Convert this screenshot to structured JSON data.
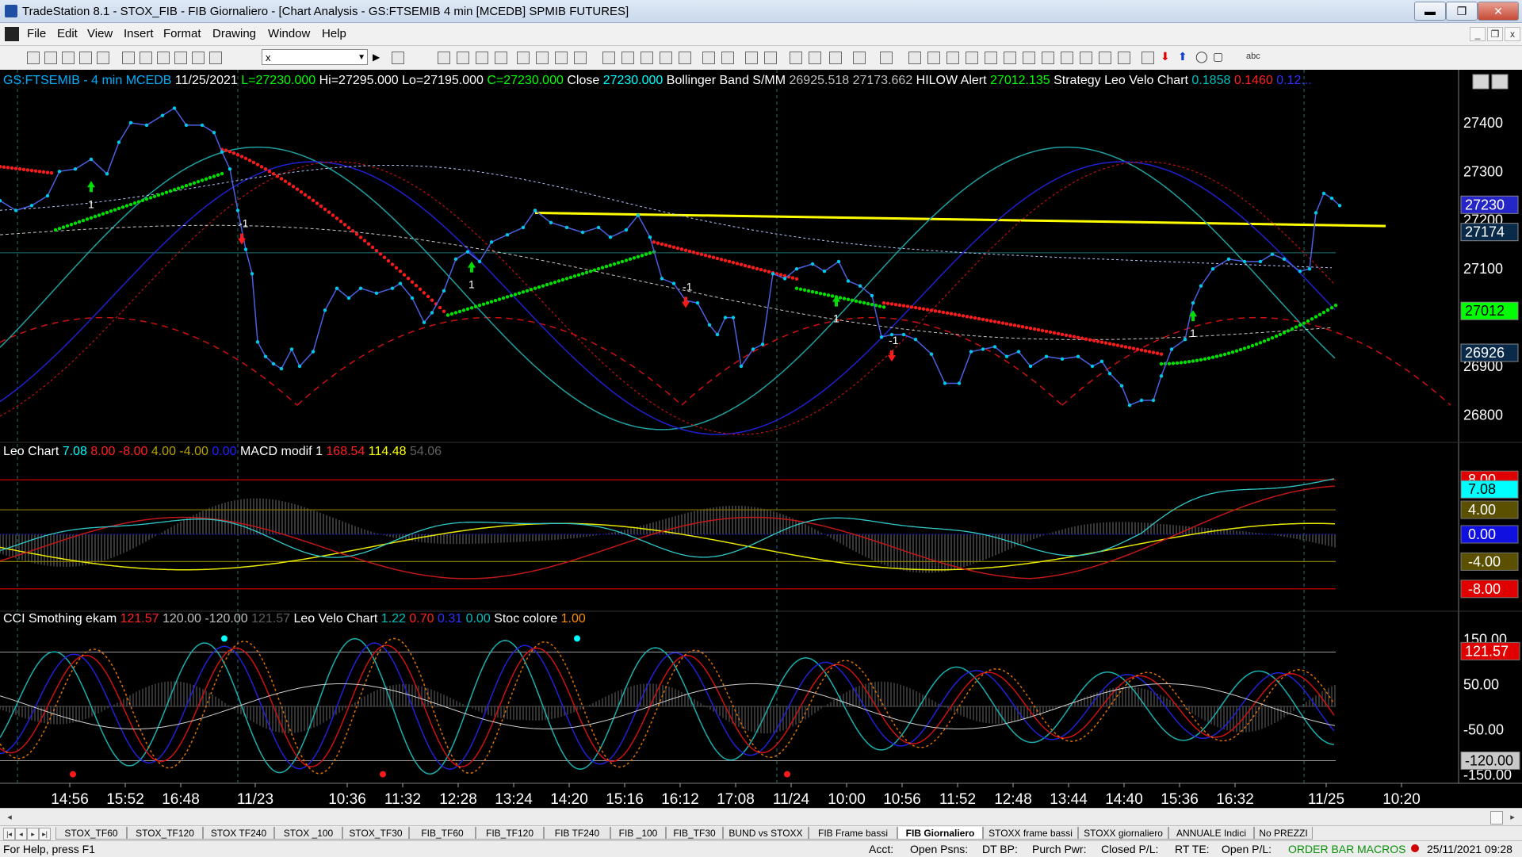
{
  "window": {
    "title": "TradeStation 8.1 - STOX_FIB - FIB Giornaliero - [Chart Analysis - GS:FTSEMIB  4 min  [MCEDB] SPMIB FUTURES]",
    "minimize_label": "▬",
    "restore_label": "❐",
    "close_label": "✕"
  },
  "menu": {
    "items": [
      "File",
      "Edit",
      "View",
      "Insert",
      "Format",
      "Drawing",
      "Window",
      "Help"
    ],
    "child_minimize": "_",
    "child_restore": "❐",
    "child_close": "x"
  },
  "toolbar": {
    "symbol_value": "x"
  },
  "price_panel": {
    "legend": [
      {
        "text": "GS:FTSEMIB - 4 min   MCEDB",
        "color": "#00b0ff"
      },
      {
        "text": "11/25/2021",
        "color": "#ffffff"
      },
      {
        "text": "L=27230.000",
        "color": "#00ff00"
      },
      {
        "text": "Hi=27295.000",
        "color": "#ffffff"
      },
      {
        "text": "Lo=27195.000",
        "color": "#ffffff"
      },
      {
        "text": "C=27230.000",
        "color": "#00ff00"
      },
      {
        "text": "Close",
        "color": "#ffffff"
      },
      {
        "text": "27230.000",
        "color": "#00ffff"
      },
      {
        "text": "Bollinger Band S/MM",
        "color": "#ffffff"
      },
      {
        "text": "26925.518",
        "color": "#c0c0c0"
      },
      {
        "text": "27173.662",
        "color": "#c0c0c0"
      },
      {
        "text": "HILOW Alert",
        "color": "#ffffff"
      },
      {
        "text": "27012.135",
        "color": "#00ff00"
      },
      {
        "text": "Strategy",
        "color": "#ffffff"
      },
      {
        "text": "Leo Velo Chart",
        "color": "#ffffff"
      },
      {
        "text": "0.1858",
        "color": "#00c0c0"
      },
      {
        "text": "0.1460",
        "color": "#ff2020"
      },
      {
        "text": "0.12...",
        "color": "#3030ff"
      }
    ],
    "y_ticks": [
      "27400",
      "27300",
      "27200",
      "27100",
      "26900",
      "26800"
    ],
    "y_min": 26760,
    "y_max": 27460,
    "markers": [
      {
        "label": "27230",
        "value": 27230,
        "bg": "#2525c8",
        "fg": "#ffffff"
      },
      {
        "label": "27174",
        "value": 27174,
        "bg": "#0a2a4a",
        "fg": "#ffffff"
      },
      {
        "label": "27012",
        "value": 27012,
        "bg": "#00ff00",
        "fg": "#000000"
      },
      {
        "label": "26926",
        "value": 26926,
        "bg": "#0a2a4a",
        "fg": "#ffffff"
      }
    ],
    "signals": [
      {
        "label": "1",
        "arrow": "up"
      },
      {
        "label": "-1",
        "arrow": "down"
      },
      {
        "label": "1",
        "arrow": "up"
      },
      {
        "label": "-1",
        "arrow": "down"
      },
      {
        "label": "1",
        "arrow": "up"
      },
      {
        "label": "-1",
        "arrow": "down"
      },
      {
        "label": "1",
        "arrow": "up"
      }
    ]
  },
  "osc_panel": {
    "legend": [
      {
        "text": "Leo Chart",
        "color": "#ffffff"
      },
      {
        "text": "7.08",
        "color": "#00ffff"
      },
      {
        "text": "8.00",
        "color": "#ff2020"
      },
      {
        "text": "-8.00",
        "color": "#ff2020"
      },
      {
        "text": "4.00",
        "color": "#b8a000"
      },
      {
        "text": "-4.00",
        "color": "#b8a000"
      },
      {
        "text": "0.00",
        "color": "#2020ff"
      },
      {
        "text": "MACD modif 1",
        "color": "#ffffff"
      },
      {
        "text": "168.54",
        "color": "#ff2020"
      },
      {
        "text": "114.48",
        "color": "#ffff00"
      },
      {
        "text": "54.06",
        "color": "#606060"
      }
    ],
    "y_min": -10,
    "y_max": 10,
    "markers": [
      {
        "label": "8.00",
        "value": 8,
        "bg": "#e00000",
        "fg": "#ffffff"
      },
      {
        "label": "7.08",
        "value": 6.6,
        "bg": "#00ffff",
        "fg": "#000000"
      },
      {
        "label": "4.00",
        "value": 3.6,
        "bg": "#5a5000",
        "fg": "#ffffff"
      },
      {
        "label": "0.00",
        "value": 0,
        "bg": "#1010e0",
        "fg": "#ffffff"
      },
      {
        "label": "-4.00",
        "value": -4,
        "bg": "#5a5000",
        "fg": "#ffffff"
      },
      {
        "label": "-8.00",
        "value": -8,
        "bg": "#e00000",
        "fg": "#ffffff"
      }
    ]
  },
  "cci_panel": {
    "legend": [
      {
        "text": "CCI Smothing ekam",
        "color": "#ffffff"
      },
      {
        "text": "121.57",
        "color": "#ff2020"
      },
      {
        "text": "120.00",
        "color": "#c0c0c0"
      },
      {
        "text": "-120.00",
        "color": "#c0c0c0"
      },
      {
        "text": "121.57",
        "color": "#606060"
      },
      {
        "text": "Leo Velo Chart",
        "color": "#ffffff"
      },
      {
        "text": "1.22",
        "color": "#00c0c0"
      },
      {
        "text": "0.70",
        "color": "#ff2020"
      },
      {
        "text": "0.31",
        "color": "#3030ff"
      },
      {
        "text": "0.00",
        "color": "#00c0c0"
      },
      {
        "text": "Stoc colore",
        "color": "#ffffff"
      },
      {
        "text": "1.00",
        "color": "#ff8c00"
      }
    ],
    "y_min": -170,
    "y_max": 170,
    "y_ticks": [
      "150.00",
      "50.00",
      "-50.00",
      "-150.00"
    ],
    "markers": [
      {
        "label": "121.57",
        "value": 122,
        "bg": "#e00000",
        "fg": "#ffffff"
      },
      {
        "label": "-120.00",
        "value": -120,
        "bg": "#c8c8c8",
        "fg": "#000000"
      }
    ]
  },
  "x_axis": {
    "labels": [
      "14:56",
      "15:52",
      "16:48",
      "11/23",
      "10:36",
      "11:32",
      "12:28",
      "13:24",
      "14:20",
      "15:16",
      "16:12",
      "17:08",
      "11/24",
      "10:00",
      "10:56",
      "11:52",
      "12:48",
      "13:44",
      "14:40",
      "15:36",
      "16:32",
      "11/25",
      "10:20"
    ]
  },
  "tabs": {
    "nav": [
      "|◂",
      "◂",
      "▸",
      "▸|"
    ],
    "items": [
      "STOX_TF60",
      "STOX_TF120",
      "STOX TF240",
      "STOX _100",
      "STOX_TF30",
      "FIB_TF60",
      "FIB_TF120",
      "FIB TF240",
      "FIB _100",
      "FIB_TF30",
      "BUND vs STOXX",
      "FIB Frame bassi",
      "FIB Giornaliero",
      "STOXX frame bassi",
      "STOXX giornaliero",
      "ANNUALE Indici",
      "No PREZZI"
    ],
    "active": "FIB Giornaliero"
  },
  "status": {
    "help": "For Help, press F1",
    "acct": "Acct:",
    "open_psns": "Open Psns:",
    "dt_bp": "DT BP:",
    "purch_pwr": "Purch Pwr:",
    "closed_pl": "Closed P/L:",
    "rt_te": "RT TE:",
    "open_pl": "Open P/L:",
    "order_bar": "ORDER BAR",
    "macros": "MACROS",
    "datetime": "25/11/2021 09:28"
  },
  "colors": {
    "price": "#00c8e8",
    "resistance": "#ffff00",
    "hilow_bear": "#ff1a1a",
    "hilow_bull": "#00e000",
    "band_mid": "#b8c8ff",
    "leo_cyan": "#30c8c8",
    "leo_red": "#c01818",
    "leo_blue": "#1a1adc",
    "level_red": "#e00000",
    "level_olive": "#8a7a00",
    "grid_teal": "#1f7070"
  }
}
